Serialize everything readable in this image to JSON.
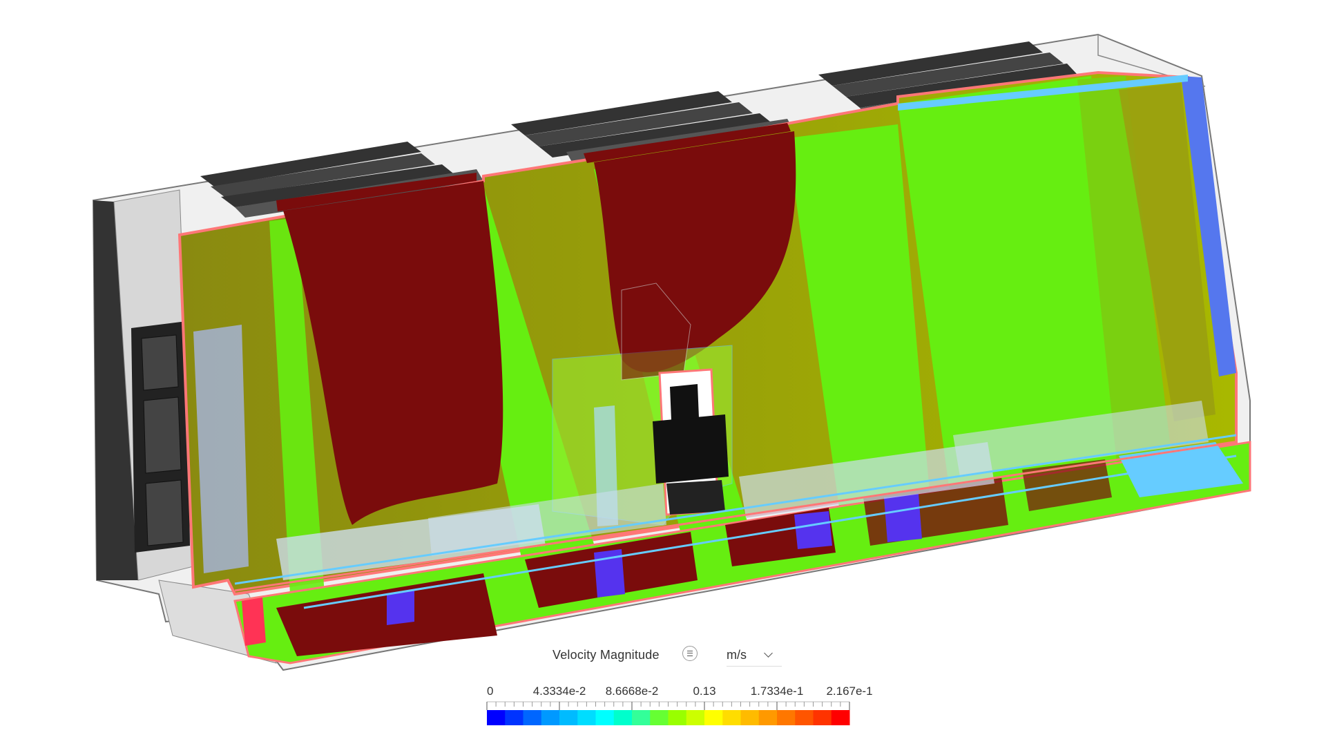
{
  "legend": {
    "title": "Velocity Magnitude",
    "unit": "m/s",
    "menu_icon": "menu-icon",
    "dropdown_icon": "chevron-down-icon",
    "tick_labels": [
      "0",
      "4.3334e-2",
      "8.6668e-2",
      "0.13",
      "1.7334e-1",
      "2.167e-1"
    ],
    "colors": [
      "#0000ff",
      "#0033ff",
      "#0066ff",
      "#0099ff",
      "#00bbff",
      "#00ddff",
      "#00ffff",
      "#00ffcc",
      "#33ff99",
      "#66ff33",
      "#99ff00",
      "#ccff00",
      "#ffff00",
      "#ffdd00",
      "#ffbb00",
      "#ff9900",
      "#ff7700",
      "#ff5500",
      "#ff3300",
      "#ff0000"
    ]
  },
  "scene": {
    "field_colors": {
      "high": "#7a0c0c",
      "mid": "#66ee11",
      "olive": "#8a8a10",
      "low": "#3344ee",
      "cyan": "#66ccff",
      "outline": "#ff7777"
    }
  }
}
